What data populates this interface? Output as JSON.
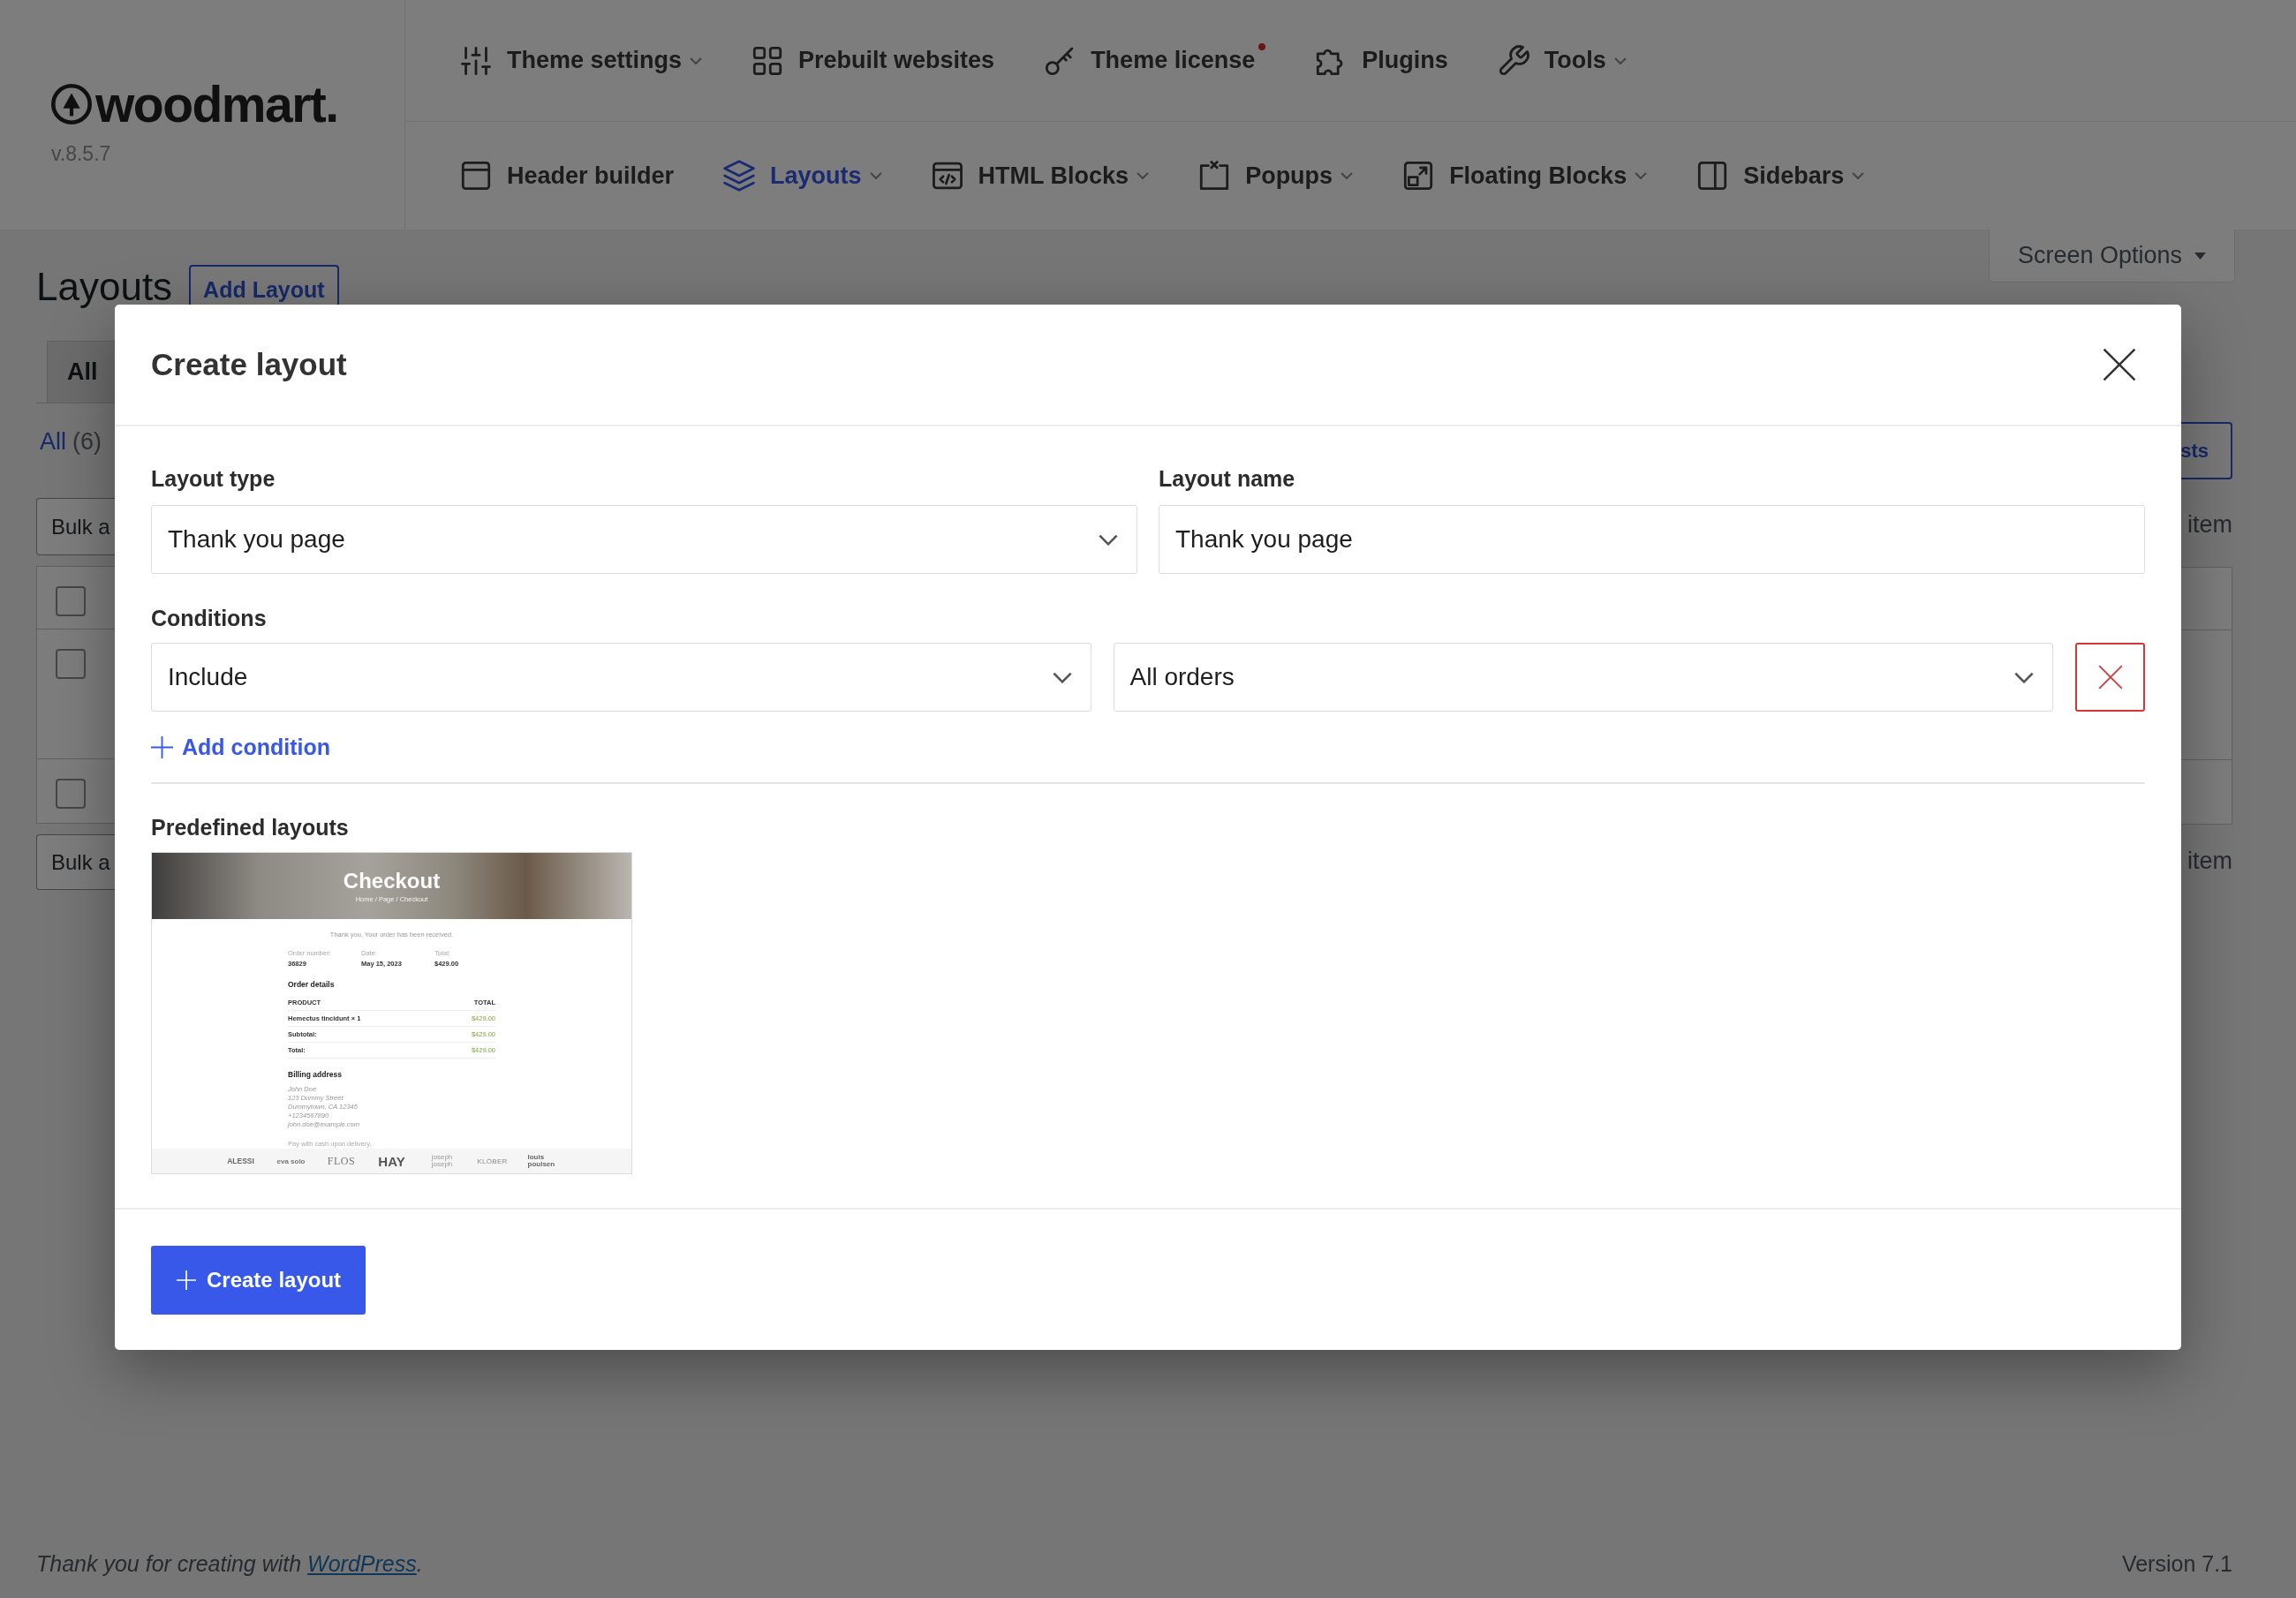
{
  "header": {
    "logo": "woodmart.",
    "version": "v.8.5.7",
    "nav_top": [
      {
        "label": "Theme settings",
        "dropdown": true,
        "notice": false,
        "selected": false
      },
      {
        "label": "Prebuilt websites",
        "dropdown": false,
        "notice": false,
        "selected": false
      },
      {
        "label": "Theme license",
        "dropdown": false,
        "notice": true,
        "selected": false
      },
      {
        "label": "Plugins",
        "dropdown": false,
        "notice": false,
        "selected": false
      },
      {
        "label": "Tools",
        "dropdown": true,
        "notice": false,
        "selected": false
      }
    ],
    "nav_bottom": [
      {
        "label": "Header builder",
        "dropdown": false,
        "selected": false
      },
      {
        "label": "Layouts",
        "dropdown": true,
        "selected": true
      },
      {
        "label": "HTML Blocks",
        "dropdown": true,
        "selected": false
      },
      {
        "label": "Popups",
        "dropdown": true,
        "selected": false
      },
      {
        "label": "Floating Blocks",
        "dropdown": true,
        "selected": false
      },
      {
        "label": "Sidebars",
        "dropdown": true,
        "selected": false
      }
    ]
  },
  "page": {
    "title": "Layouts",
    "add_button": "Add Layout",
    "screen_options": "Screen Options",
    "tabs": [
      {
        "label": "All",
        "selected": true
      }
    ],
    "views": [
      {
        "label": "All",
        "count": "(6)",
        "selected": true
      }
    ],
    "bulk_actions": [
      "Bulk a",
      "Bulk a"
    ],
    "rows": [
      {
        "kind": "header",
        "checked": false
      },
      {
        "kind": "item",
        "checked": false
      },
      {
        "kind": "footer",
        "checked": false
      }
    ],
    "column_right": {
      "button": "sts",
      "counts": [
        "item",
        "item"
      ]
    }
  },
  "modal": {
    "title": "Create layout",
    "fields": [
      {
        "label": "Layout type",
        "kind": "select",
        "value": "Thank you page"
      },
      {
        "label": "Layout name",
        "kind": "text",
        "value": "Thank you page"
      }
    ],
    "conditions": {
      "label": "Conditions",
      "rows": [
        {
          "type": "Include",
          "target": "All orders"
        }
      ],
      "add": "Add condition"
    },
    "predefined": {
      "label": "Predefined layouts",
      "items": [
        {
          "selected": false,
          "preview": {
            "banner_title": "Checkout",
            "breadcrumb": "Home / Page / Checkout",
            "notice": "Thank you. Your order has been received.",
            "overview": [
              {
                "label": "Order number:",
                "value": "36829"
              },
              {
                "label": "Date:",
                "value": "May 15, 2023"
              },
              {
                "label": "Total:",
                "value": "$429.00"
              }
            ],
            "details_title": "Order details",
            "columns": [
              "PRODUCT",
              "TOTAL"
            ],
            "rows": [
              {
                "label": "Hemectus tincidunt × 1",
                "amount": "$429.00"
              },
              {
                "label": "Subtotal:",
                "amount": "$429.00"
              },
              {
                "label": "Total:",
                "amount": "$429.00"
              }
            ],
            "billing_title": "Billing address",
            "address": [
              "John Doe",
              "123 Dummy Street",
              "Dummytown, CA 12345",
              "+1234567890",
              "john.doe@example.com"
            ],
            "payment_note": "Pay with cash upon delivery.",
            "brands": [
              "ALESSI",
              "eva solo",
              "FLOS",
              "HAY",
              "joseph joseph",
              "KLÖBER",
              "louis poulsen"
            ]
          }
        }
      ]
    },
    "submit": "Create layout"
  },
  "footer": {
    "credit": {
      "text": "Thank you for creating with",
      "link": "WordPress",
      "end": "."
    },
    "version": "Version 7.1"
  }
}
